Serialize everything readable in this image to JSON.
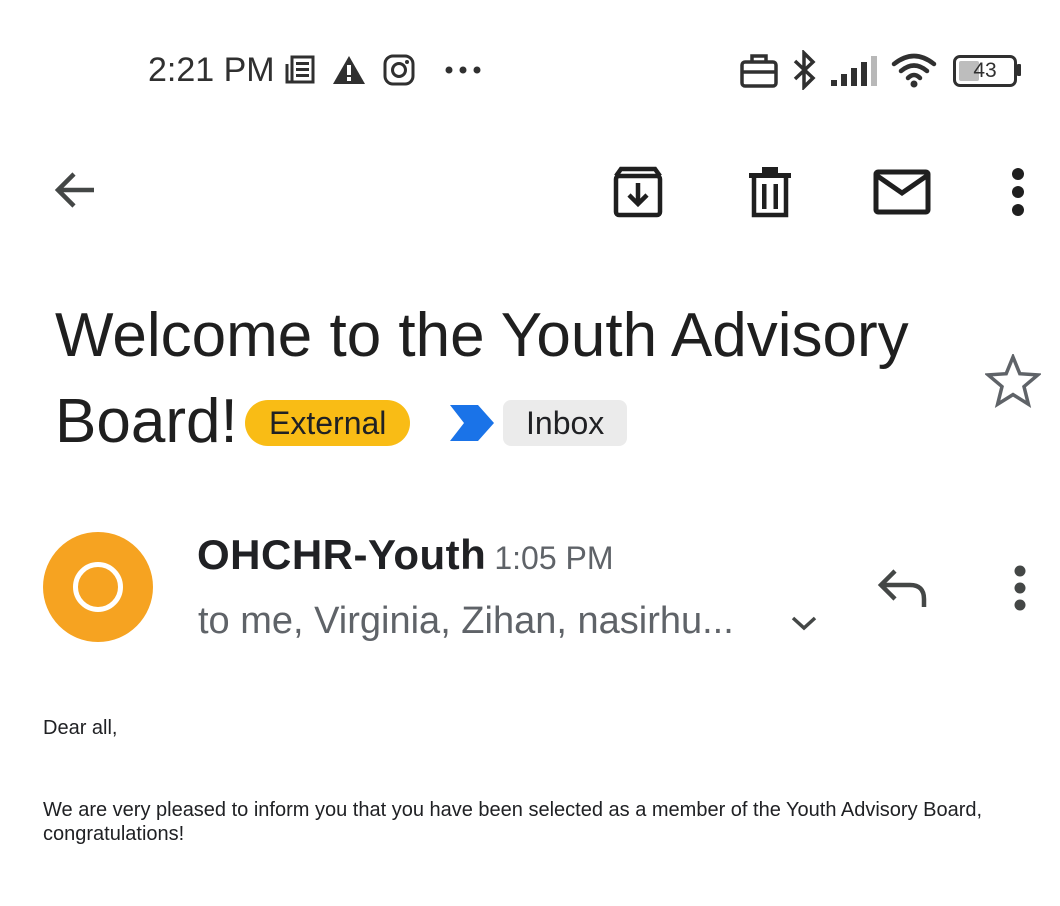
{
  "status_bar": {
    "time": "2:21 PM",
    "battery": "43",
    "icons": [
      "news-icon",
      "alert-icon",
      "instagram-icon",
      "more-dots-icon",
      "work-profile-icon",
      "bluetooth-icon",
      "signal-icon",
      "wifi-icon",
      "battery-icon"
    ]
  },
  "toolbar": {
    "icons": [
      "back-arrow-icon",
      "archive-icon",
      "delete-icon",
      "mark-unread-icon",
      "more-vert-icon"
    ]
  },
  "email": {
    "subject_line1": "Welcome to the Youth Advisory",
    "subject_line2": "Board!",
    "label_external": "External",
    "label_inbox": "Inbox",
    "sender": "OHCHR-Youth",
    "time": "1:05 PM",
    "recipients": "to me, Virginia, Zihan, nasirhu...",
    "body": {
      "greeting": "Dear all,",
      "paragraph1": "We are very pleased to inform you that you have been selected as a member of the Youth Advisory Board, congratulations!"
    }
  },
  "colors": {
    "external_chip": "#f9bc15",
    "inbox_chip": "#ebebeb",
    "importance_marker": "#1a73e8",
    "avatar": "#f6a321"
  }
}
